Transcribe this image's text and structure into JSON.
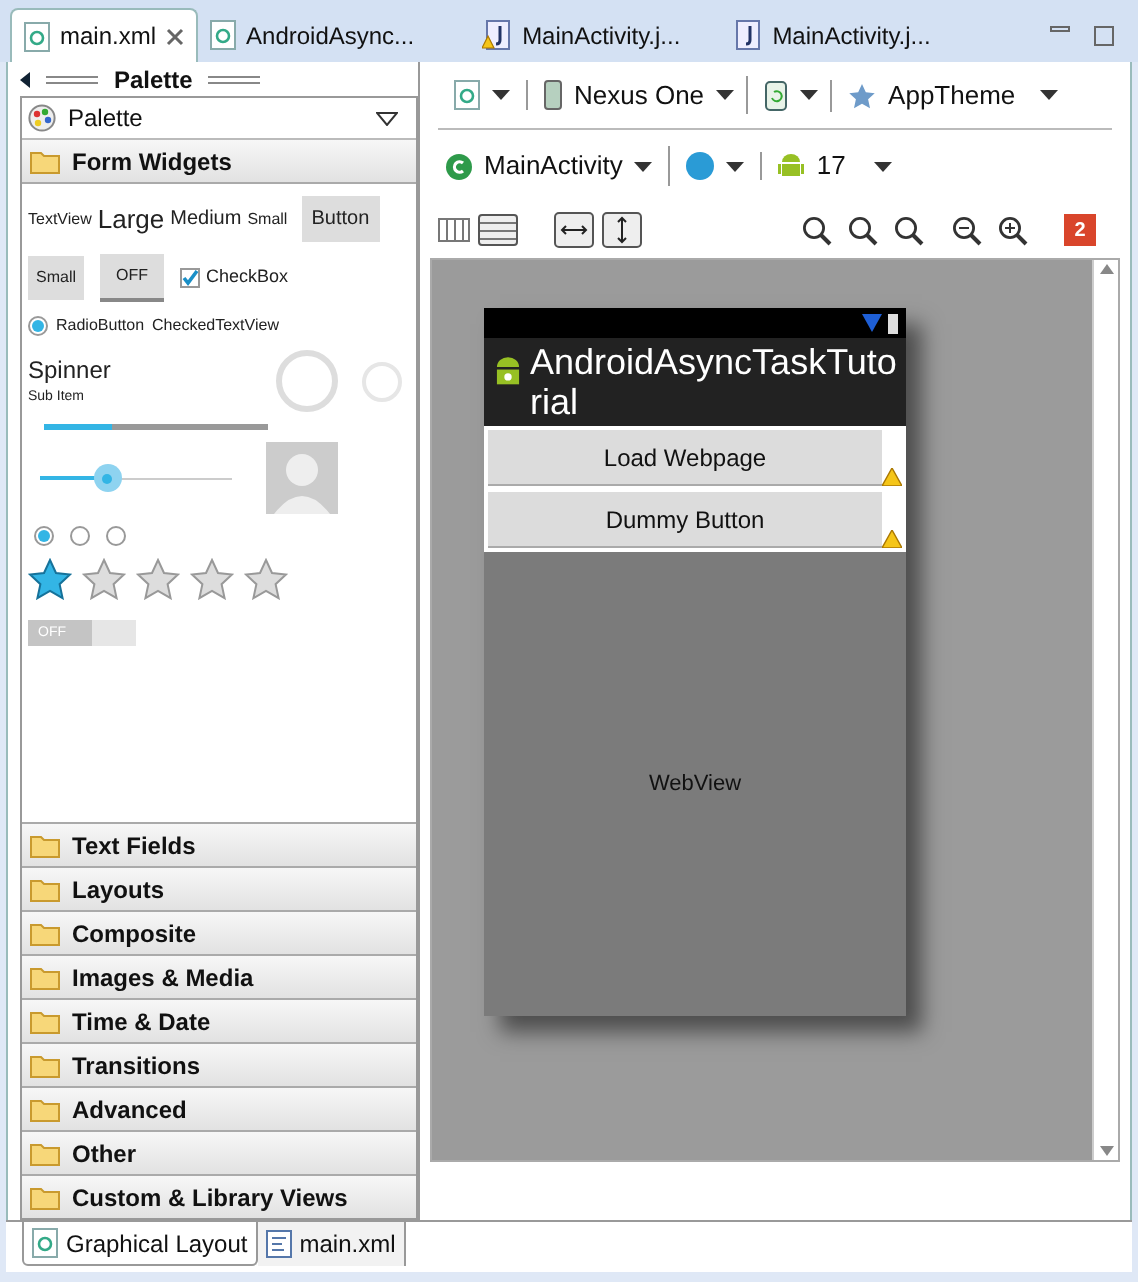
{
  "editor_tabs": [
    {
      "label": "main.xml",
      "kind": "layout",
      "selected": true,
      "closable": true
    },
    {
      "label": "AndroidAsync...",
      "kind": "layout",
      "selected": false,
      "closable": false
    },
    {
      "label": "MainActivity.j...",
      "kind": "java-warning",
      "selected": false,
      "closable": false
    },
    {
      "label": "MainActivity.j...",
      "kind": "java",
      "selected": false,
      "closable": false
    }
  ],
  "palette": {
    "title": "Palette",
    "dropdown": "Palette",
    "open_category": "Form Widgets",
    "widgets": {
      "text_views": [
        {
          "label": "TextView",
          "kind": "plain"
        },
        {
          "label": "Large",
          "kind": "large"
        },
        {
          "label": "Medium",
          "kind": "medium"
        },
        {
          "label": "Small",
          "kind": "small"
        }
      ],
      "button": "Button",
      "small_button": "Small",
      "toggle": "OFF",
      "checkbox": {
        "label": "CheckBox",
        "checked": true
      },
      "radio": {
        "label": "RadioButton",
        "selected": true
      },
      "checked_text": "CheckedTextView",
      "spinner": {
        "title": "Spinner",
        "subtitle": "Sub Item"
      },
      "progress": {
        "level": 0.3
      },
      "seekbar": {
        "level": 0.35
      },
      "radios": [
        {
          "selected": true
        },
        {
          "selected": false
        },
        {
          "selected": false
        }
      ],
      "rating": {
        "stars": 1
      },
      "switch": "OFF"
    },
    "categories": [
      "Text Fields",
      "Layouts",
      "Composite",
      "Images & Media",
      "Time & Date",
      "Transitions",
      "Advanced",
      "Other",
      "Custom & Library Views"
    ]
  },
  "toolbar": {
    "device": "Nexus One",
    "theme": "AppTheme",
    "activity": "MainActivity",
    "api": "17",
    "errors": "2"
  },
  "phone": {
    "title": "AndroidAsyncTaskTutorial",
    "buttons": [
      "Load Webpage",
      "Dummy Button"
    ],
    "webview": "WebView"
  },
  "bottom_tabs": [
    {
      "label": "Graphical Layout",
      "kind": "layout",
      "selected": true
    },
    {
      "label": "main.xml",
      "kind": "xml",
      "selected": false
    }
  ]
}
